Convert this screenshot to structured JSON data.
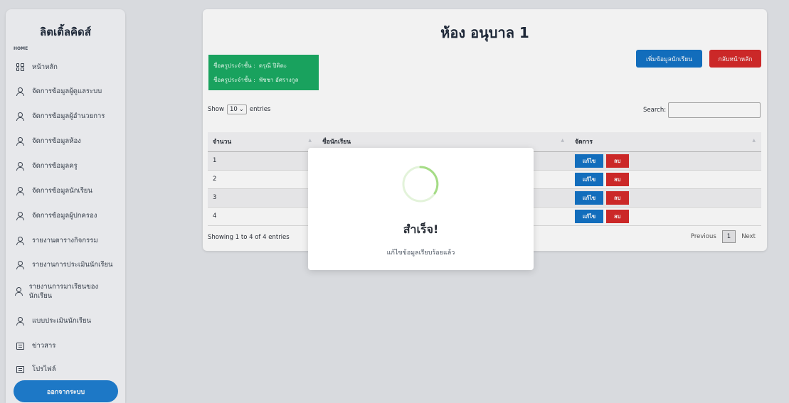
{
  "sidebar": {
    "brand": "ลิตเติ้ลคิดส์",
    "section": "HOME",
    "items": [
      {
        "label": "หน้าหลัก",
        "icon": "grid-icon"
      },
      {
        "label": "จัดการข้อมูลผู้ดูแลระบบ",
        "icon": "user-icon"
      },
      {
        "label": "จัดการข้อมูลผู้อำนวยการ",
        "icon": "user-icon"
      },
      {
        "label": "จัดการข้อมูลห้อง",
        "icon": "user-icon"
      },
      {
        "label": "จัดการข้อมูลครู",
        "icon": "user-icon"
      },
      {
        "label": "จัดการข้อมูลนักเรียน",
        "icon": "user-icon"
      },
      {
        "label": "จัดการข้อมูลผู้ปกครอง",
        "icon": "user-icon"
      },
      {
        "label": "รายงานตารางกิจกรรม",
        "icon": "user-icon"
      },
      {
        "label": "รายงานการประเมินนักเรียน",
        "icon": "user-icon"
      },
      {
        "label": "รายงานการมาเรียนของนักเรียน",
        "icon": "user-icon"
      },
      {
        "label": "แบบประเมินนักเรียน",
        "icon": "user-icon"
      },
      {
        "label": "ข่าวสาร",
        "icon": "document-icon"
      },
      {
        "label": "โปรไฟล์",
        "icon": "document-icon"
      }
    ],
    "logout": "ออกจากระบบ"
  },
  "main": {
    "title": "ห้อง อนุบาล 1",
    "teachers": [
      {
        "label": "ชื่อครูประจำชั้น :",
        "name": "ดรุณี ปิติดะ"
      },
      {
        "label": "ชื่อครูประจำชั้น :",
        "name": "พัชชา อัศรางกูล"
      }
    ],
    "add_student": "เพิ่มข้อมูลนักเรียน",
    "back_home": "กลับหน้าหลัก",
    "show_label": "Show",
    "show_value": "10",
    "entries_label": "entries",
    "search_label": "Search:",
    "columns": [
      "จำนวน",
      "ชื่อนักเรียน",
      "จัดการ"
    ],
    "rows": [
      {
        "no": "1",
        "name": ""
      },
      {
        "no": "2",
        "name": ""
      },
      {
        "no": "3",
        "name": ""
      },
      {
        "no": "4",
        "name": ""
      }
    ],
    "edit_label": "แก้ไข",
    "delete_label": "ลบ",
    "info": "Showing 1 to 4 of 4 entries",
    "prev": "Previous",
    "page": "1",
    "next": "Next"
  },
  "modal": {
    "title": "สำเร็จ!",
    "message": "แก้ไขข้อมูลเรียบร้อยแล้ว"
  }
}
